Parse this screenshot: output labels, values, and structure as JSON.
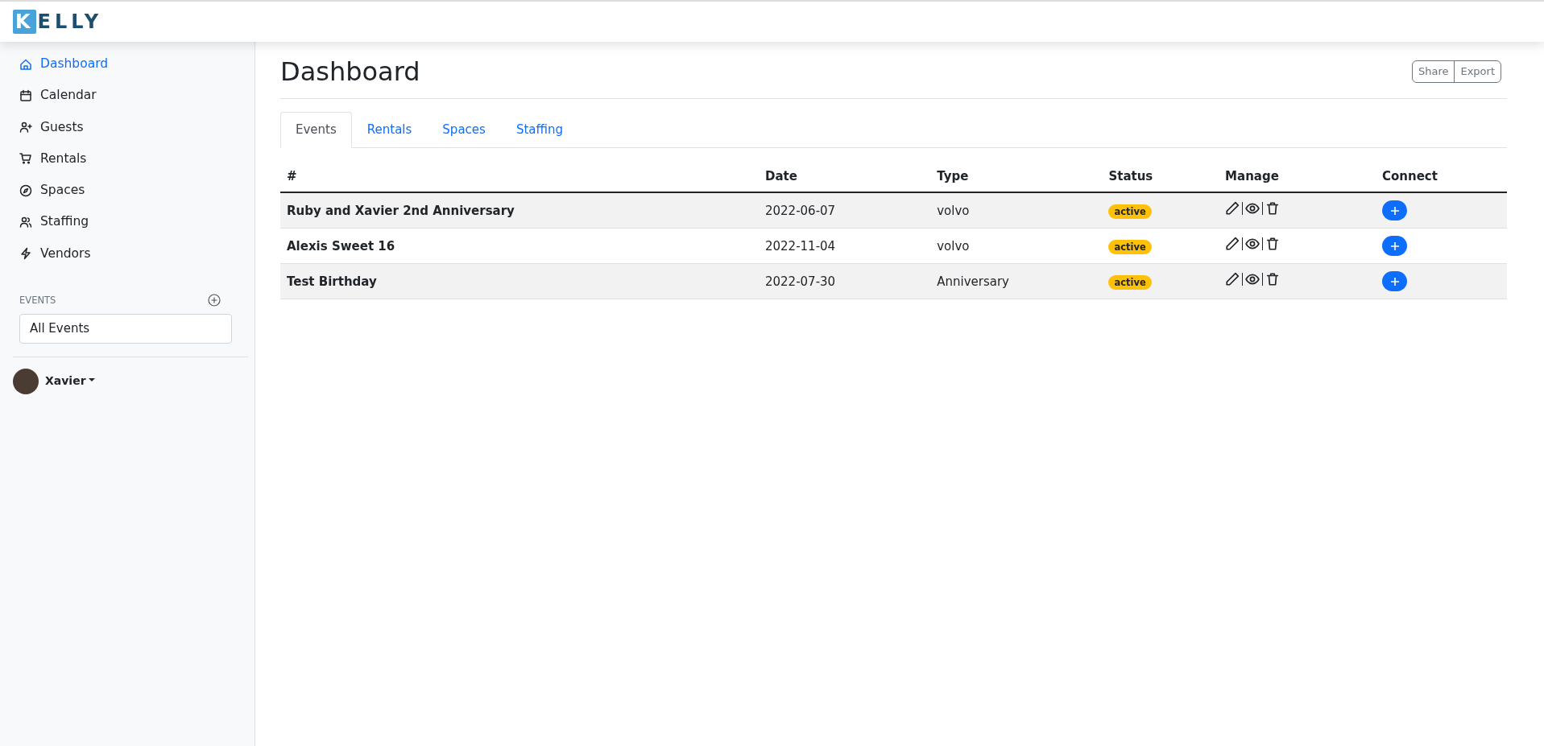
{
  "logo": {
    "text": "KELLY"
  },
  "sidebar": {
    "items": [
      {
        "label": "Dashboard",
        "selected": true
      },
      {
        "label": "Calendar",
        "selected": false
      },
      {
        "label": "Guests",
        "selected": false
      },
      {
        "label": "Rentals",
        "selected": false
      },
      {
        "label": "Spaces",
        "selected": false
      },
      {
        "label": "Staffing",
        "selected": false
      },
      {
        "label": "Vendors",
        "selected": false
      }
    ],
    "events_heading": "EVENTS",
    "events_select": {
      "value": "All Events"
    },
    "user": {
      "name": "Xavier"
    }
  },
  "page": {
    "title": "Dashboard",
    "buttons": [
      "Share",
      "Export"
    ]
  },
  "tabs": [
    {
      "label": "Events",
      "selected": true
    },
    {
      "label": "Rentals",
      "selected": false
    },
    {
      "label": "Spaces",
      "selected": false
    },
    {
      "label": "Staffing",
      "selected": false
    }
  ],
  "table": {
    "columns": [
      "#",
      "Date",
      "Type",
      "Status",
      "Manage",
      "Connect"
    ],
    "rows": [
      {
        "name": "Ruby and Xavier 2nd Anniversary",
        "date": "2022-06-07",
        "type": "volvo",
        "status": "active"
      },
      {
        "name": "Alexis Sweet 16",
        "date": "2022-11-04",
        "type": "volvo",
        "status": "active"
      },
      {
        "name": "Test Birthday",
        "date": "2022-07-30",
        "type": "Anniversary",
        "status": "active"
      }
    ]
  }
}
